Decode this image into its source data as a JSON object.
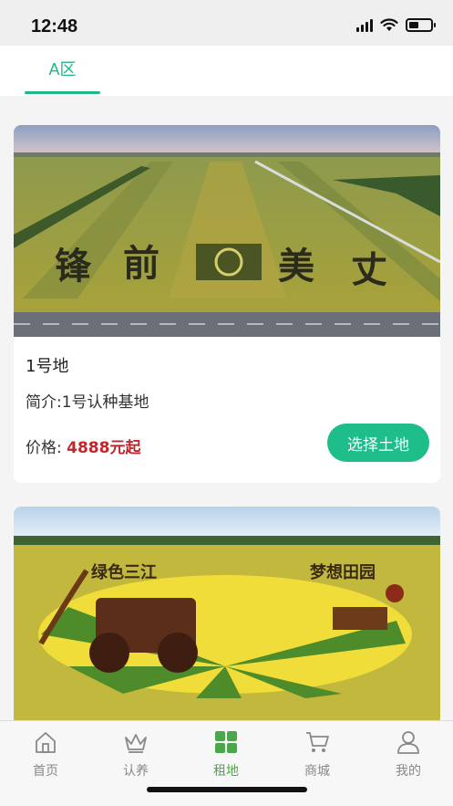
{
  "status_bar": {
    "time": "12:48"
  },
  "tabs": [
    {
      "label": "A区"
    }
  ],
  "plots": [
    {
      "title": "1号地",
      "description": "简介:1号认种基地",
      "price_label": "价格:",
      "price_value": "4888元起",
      "button_label": "选择土地",
      "image_text": [
        "锋前美丈"
      ]
    },
    {
      "image_text": [
        "绿色三江",
        "梦想田园"
      ]
    }
  ],
  "bottom_nav": [
    {
      "label": "首页",
      "icon": "home-icon"
    },
    {
      "label": "认养",
      "icon": "crown-icon"
    },
    {
      "label": "租地",
      "icon": "grid-icon"
    },
    {
      "label": "商城",
      "icon": "cart-icon"
    },
    {
      "label": "我的",
      "icon": "user-icon"
    }
  ],
  "colors": {
    "accent": "#1fb886",
    "price": "#c0272d",
    "nav_active": "#4aa84a",
    "nav_inactive": "#888888"
  }
}
